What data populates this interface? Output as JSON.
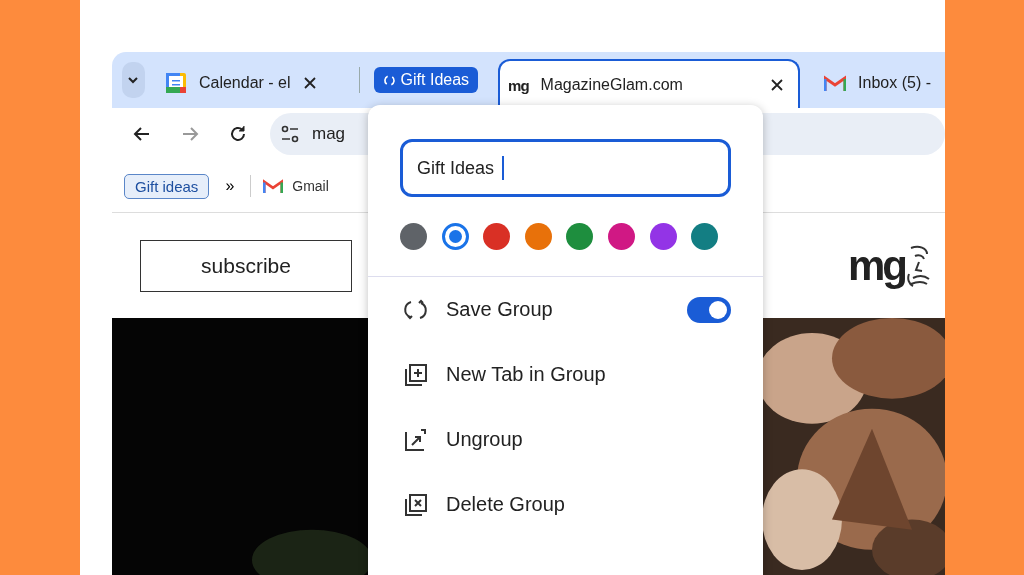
{
  "tabs": [
    {
      "label": "Calendar - el",
      "kind": "calendar",
      "selected": false
    },
    {
      "label": "MagazineGlam.com",
      "kind": "site",
      "favicon": "mg",
      "selected": true
    },
    {
      "label": "Inbox (5) -",
      "kind": "mail",
      "selected": false
    }
  ],
  "tab_group": {
    "label": "Gift Ideas",
    "color": "#1a5cd6"
  },
  "address_bar": {
    "value": "mag"
  },
  "bookmarks": {
    "group": "Gift ideas",
    "overflow": "»",
    "items": [
      {
        "label": "Gmail"
      }
    ]
  },
  "page": {
    "subscribe": "subscribe",
    "logo": "mg"
  },
  "group_editor": {
    "name": "Gift Ideas",
    "colors": [
      {
        "color": "#5f6368",
        "selected": false
      },
      {
        "color": "#1a73e8",
        "selected": true
      },
      {
        "color": "#d93025",
        "selected": false
      },
      {
        "color": "#e8710a",
        "selected": false
      },
      {
        "color": "#1e8e3e",
        "selected": false
      },
      {
        "color": "#d01884",
        "selected": false
      },
      {
        "color": "#9334e6",
        "selected": false
      },
      {
        "color": "#137e83",
        "selected": false
      }
    ],
    "items": [
      {
        "label": "Save Group",
        "kind": "save",
        "on": true
      },
      {
        "label": "New Tab in Group",
        "kind": "new"
      },
      {
        "label": "Ungroup",
        "kind": "ungroup"
      },
      {
        "label": "Delete Group",
        "kind": "delete"
      }
    ]
  }
}
